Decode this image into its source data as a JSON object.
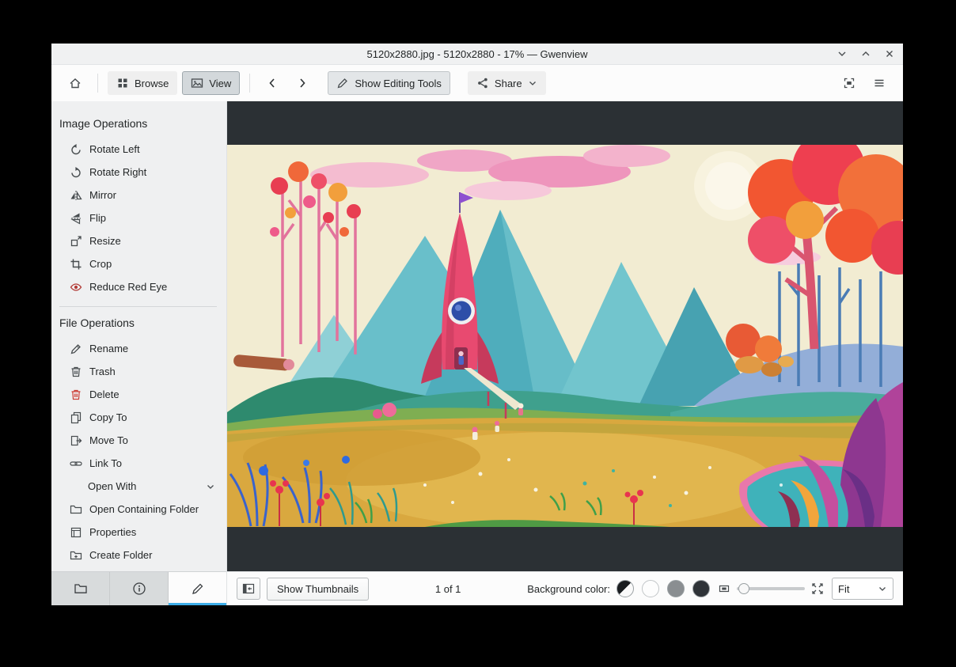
{
  "window": {
    "title": "5120x2880.jpg - 5120x2880 - 17% — Gwenview"
  },
  "toolbar": {
    "browse": "Browse",
    "view": "View",
    "show_editing_tools": "Show Editing Tools",
    "share": "Share"
  },
  "sidebar": {
    "image_operations": {
      "title": "Image Operations",
      "items": [
        {
          "label": "Rotate Left"
        },
        {
          "label": "Rotate Right"
        },
        {
          "label": "Mirror"
        },
        {
          "label": "Flip"
        },
        {
          "label": "Resize"
        },
        {
          "label": "Crop"
        },
        {
          "label": "Reduce Red Eye"
        }
      ]
    },
    "file_operations": {
      "title": "File Operations",
      "items": [
        {
          "label": "Rename"
        },
        {
          "label": "Trash"
        },
        {
          "label": "Delete"
        },
        {
          "label": "Copy To"
        },
        {
          "label": "Move To"
        },
        {
          "label": "Link To"
        },
        {
          "label": "Open With"
        },
        {
          "label": "Open Containing Folder"
        },
        {
          "label": "Properties"
        },
        {
          "label": "Create Folder"
        }
      ]
    }
  },
  "statusbar": {
    "show_thumbnails": "Show Thumbnails",
    "page_indicator": "1 of 1",
    "background_color_label": "Background color:",
    "zoom_mode": "Fit",
    "background_swatches": [
      {
        "name": "auto",
        "colors": [
          "#1a1d20",
          "#fafafa"
        ]
      },
      {
        "name": "white",
        "color": "#fdfdfd"
      },
      {
        "name": "gray",
        "color": "#8a8e91"
      },
      {
        "name": "dark",
        "color": "#2f3338"
      }
    ]
  },
  "colors": {
    "accent": "#3daee9",
    "viewer_background": "#2b3034",
    "sidebar_background": "#eff0f1"
  }
}
